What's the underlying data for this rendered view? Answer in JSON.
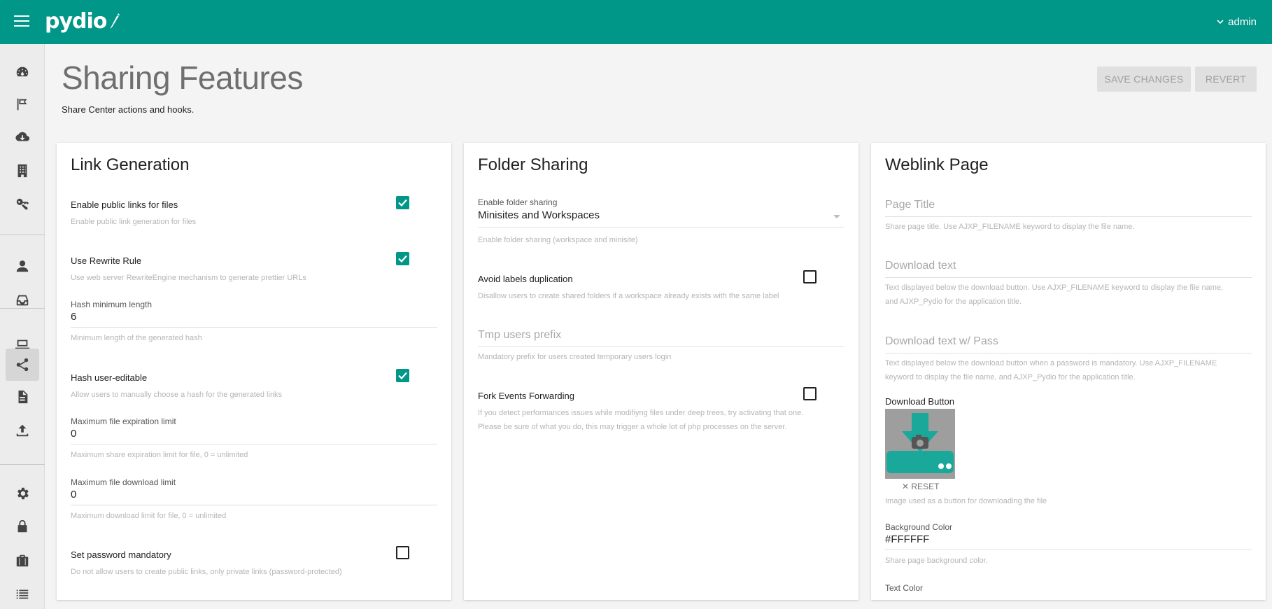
{
  "app": {
    "logo_text": "pydio",
    "user": "admin"
  },
  "sidebar": {
    "items": [
      {
        "icon": "dashboard-icon"
      },
      {
        "icon": "flag-icon"
      },
      {
        "icon": "cloud-download-icon"
      },
      {
        "icon": "building-icon"
      },
      {
        "icon": "key-icon"
      },
      {
        "icon": "person-icon"
      },
      {
        "icon": "inbox-icon"
      },
      {
        "icon": "laptop-icon"
      },
      {
        "icon": "share-icon",
        "active": true
      },
      {
        "icon": "document-icon"
      },
      {
        "icon": "upload-icon"
      },
      {
        "icon": "gear-icon"
      },
      {
        "icon": "lock-icon"
      },
      {
        "icon": "briefcase-icon"
      },
      {
        "icon": "list-icon"
      }
    ]
  },
  "header": {
    "title": "Sharing Features",
    "subtitle": "Share Center actions and hooks.",
    "save_label": "SAVE CHANGES",
    "revert_label": "REVERT"
  },
  "link_generation": {
    "title": "Link Generation",
    "public_links_label": "Enable public links for files",
    "public_links_help": "Enable public link generation for files",
    "public_links_checked": true,
    "rewrite_label": "Use Rewrite Rule",
    "rewrite_help": "Use web server RewriteEngine mechanism to generate prettier URLs",
    "rewrite_checked": true,
    "hash_min_label": "Hash minimum length",
    "hash_min_value": "6",
    "hash_min_help": "Minimum length of the generated hash",
    "hash_editable_label": "Hash user-editable",
    "hash_editable_help": "Allow users to manually choose a hash for the generated links",
    "hash_editable_checked": true,
    "max_expiration_label": "Maximum file expiration limit",
    "max_expiration_value": "0",
    "max_expiration_help": "Maximum share expiration limit for file, 0 = unlimited",
    "max_download_label": "Maximum file download limit",
    "max_download_value": "0",
    "max_download_help": "Maximum download limit for file, 0 = unlimited",
    "password_label": "Set password mandatory",
    "password_help": "Do not allow users to create public links, only private links (password-protected)",
    "password_checked": false
  },
  "folder_sharing": {
    "title": "Folder Sharing",
    "enable_label": "Enable folder sharing",
    "enable_value": "Minisites and Workspaces",
    "enable_help": "Enable folder sharing (workspace and minisite)",
    "avoid_dup_label": "Avoid labels duplication",
    "avoid_dup_help": "Disallow users to create shared folders if a workspace already exists with the same label",
    "avoid_dup_checked": false,
    "tmp_prefix_placeholder": "Tmp users prefix",
    "tmp_prefix_help": "Mandatory prefix for users created temporary users login",
    "fork_label": "Fork Events Forwarding",
    "fork_help_1": "If you detect performances issues while modifiyng files under deep trees, try activating that one.",
    "fork_help_2": "Please be sure of what you do, this may trigger a whole lot of php processes on the server.",
    "fork_checked": false
  },
  "weblink_page": {
    "title": "Weblink Page",
    "page_title_placeholder": "Page Title",
    "page_title_help": "Share page title. Use AJXP_FILENAME keyword to display the file name.",
    "download_text_placeholder": "Download text",
    "download_text_help_1": "Text displayed below the download button. Use AJXP_FILENAME keyword to display the file name,",
    "download_text_help_2": "and AJXP_Pydio for the application title.",
    "download_pass_placeholder": "Download text w/ Pass",
    "download_pass_help_1": "Text displayed below the download button when a password is mandatory. Use AJXP_FILENAME",
    "download_pass_help_2": "keyword to display the file name, and AJXP_Pydio for the application title.",
    "download_button_label": "Download Button",
    "reset_label": "RESET",
    "download_button_help": "Image used as a button for downloading the file",
    "bg_color_label": "Background Color",
    "bg_color_value": "#FFFFFF",
    "bg_color_help": "Share page background color.",
    "text_color_label": "Text Color"
  },
  "colors": {
    "brand": "#009688",
    "checkbox": "#009688"
  }
}
